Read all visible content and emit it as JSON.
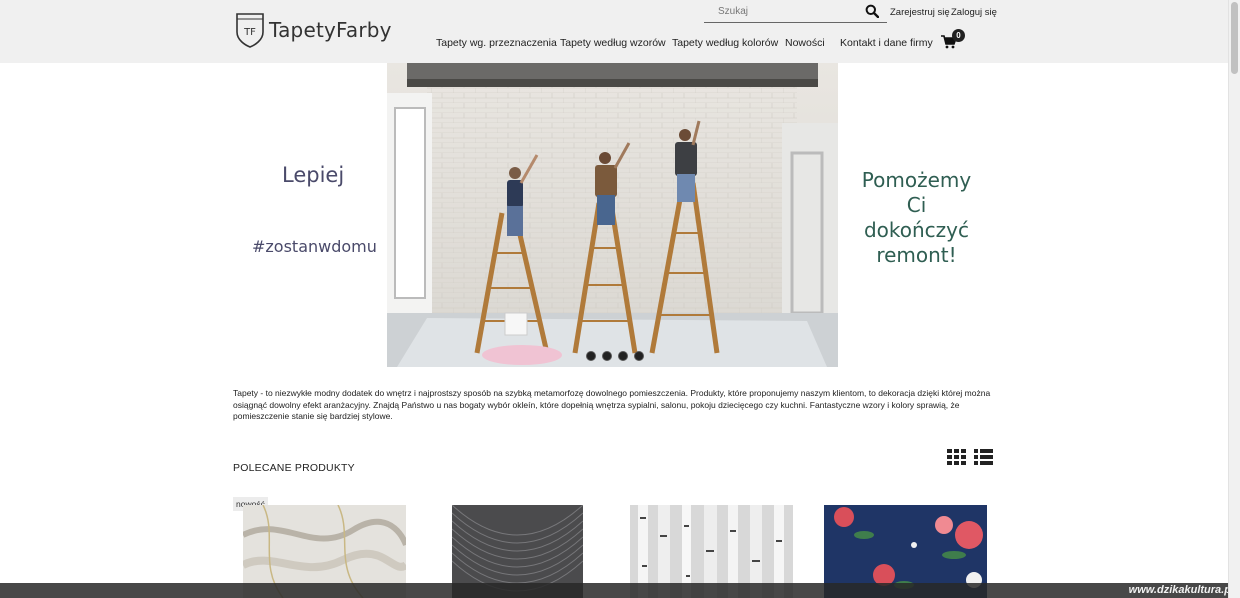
{
  "brand": {
    "logo_initials": "TF",
    "name": "TapetyFarby"
  },
  "search": {
    "placeholder": "Szukaj"
  },
  "account": {
    "register": "Zarejestruj się",
    "login": "Zaloguj się"
  },
  "nav": [
    {
      "label": "Tapety wg. przeznaczenia"
    },
    {
      "label": "Tapety według wzorów"
    },
    {
      "label": "Tapety według kolorów"
    },
    {
      "label": "Nowości"
    },
    {
      "label": "Kontakt i dane firmy"
    }
  ],
  "cart": {
    "count": "0",
    "icon": "cart-icon"
  },
  "hero": {
    "left_line1": "Lepiej",
    "left_line2": "#zostanwdomu",
    "right_line1": "Pomożemy",
    "right_line2": "Ci",
    "right_line3": "dokończyć",
    "right_line4": "remont!",
    "slide_count": 4
  },
  "intro": "Tapety - to niezwykłe modny dodatek do wnętrz i najprostszy sposób na szybką metamorfozę dowolnego pomieszczenia. Produkty, które proponujemy naszym klientom, to dekoracja dzięki której można osiągnąć dowolny efekt aranżacyjny. Znajdą Państwo u nas bogaty wybór okleín, które dopełnią wnętrza sypialni, salonu, pokoju dziecięcego czy kuchni. Fantastyczne wzory i kolory sprawią, że pomieszczenie stanie się bardziej stylowe.",
  "products_section": {
    "title": "POLECANE PRODUKTY",
    "badge": "nowość"
  },
  "watermark": "www.dzikakultura.pl",
  "colors": {
    "header_bg": "#f0f0f0",
    "hero_left_text": "#4a4a6a",
    "hero_right_text": "#2f5e52"
  }
}
